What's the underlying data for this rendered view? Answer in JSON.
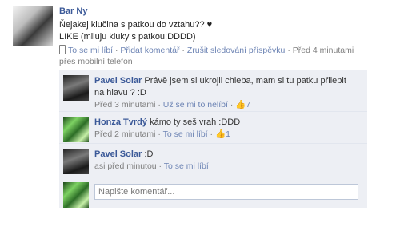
{
  "post": {
    "author": "Bar Ny",
    "message_line1": "Ňejakej klučina s patkou do vztahu?? ♥",
    "message_line2": "LIKE (miluju kluky s patkou:DDDD)",
    "actions": [
      "To se mi líbí",
      "Přidat komentář",
      "Zrušit sledování příspěvku"
    ],
    "time": "Před 4 minutami",
    "via": "přes mobilní telefon"
  },
  "comments": [
    {
      "author": "Pavel Solar",
      "text": "Právě jsem si ukrojil chleba, mam si tu patku přilepit na hlavu ? :D",
      "time": "Před 3 minutami",
      "action": "Už se mi to nelíbí",
      "likes": "7",
      "avatar": "dark"
    },
    {
      "author": "Honza Tvrdý",
      "text": "kámo ty seš vrah :DDD",
      "time": "Před 2 minutami",
      "action": "To se mi líbí",
      "likes": "1",
      "avatar": "green"
    },
    {
      "author": "Pavel Solar",
      "text": ":D",
      "time": "asi před minutou",
      "action": "To se mi líbí",
      "likes": "",
      "avatar": "dark"
    }
  ],
  "comment_box": {
    "placeholder": "Napište komentář..."
  },
  "icons": {
    "like": "thumbs-up-icon",
    "mobile": "mobile-phone-icon"
  },
  "colors": {
    "link": "#3b5998",
    "comment_bg": "#edeff4"
  }
}
